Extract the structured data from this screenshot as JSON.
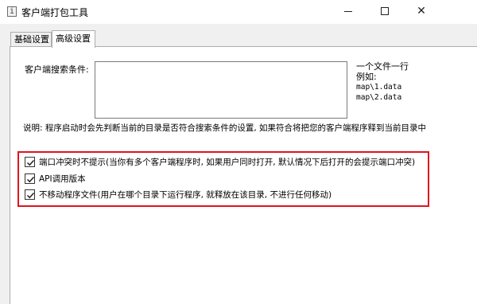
{
  "window": {
    "title": "客户端打包工具",
    "icon_name": "app-icon",
    "buttons": {
      "minimize_icon": "minimize-icon",
      "maximize_icon": "maximize-icon",
      "close_glyph": "✕"
    }
  },
  "tabs": [
    {
      "label": "基础设置",
      "active": false
    },
    {
      "label": "高级设置",
      "active": true
    }
  ],
  "search": {
    "label": "客户端搜索条件:",
    "value": ""
  },
  "hint": {
    "line1": "一个文件一行",
    "line2": "例如:",
    "example1": "map\\1.data",
    "example2": "map\\2.data"
  },
  "note": "说明: 程序启动时会先判断当前的目录是否符合搜索条件的设置, 如果符合将把您的客户端程序释到当前目录中",
  "options": [
    {
      "label": "端口冲突时不提示(当你有多个客户端程序时, 如果用户同时打开, 默认情况下后打开的会提示端口冲突)",
      "checked": true
    },
    {
      "label": "API调用版本",
      "checked": true
    },
    {
      "label": "不移动程序文件(用户在哪个目录下运行程序, 就释放在该目录, 不进行任何移动)",
      "checked": true
    }
  ],
  "colors": {
    "highlight_border": "#e0141e",
    "panel_bg": "#ffffff",
    "window_bg": "#f0f0f0"
  }
}
